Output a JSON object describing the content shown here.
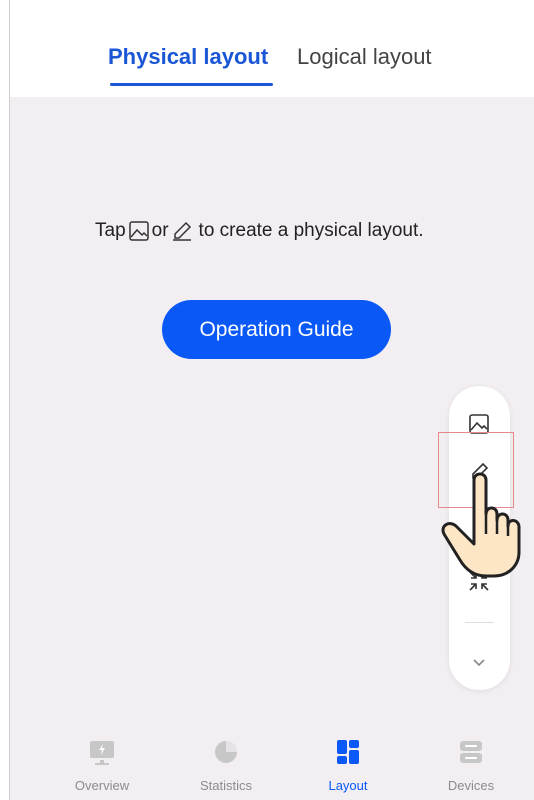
{
  "tabs": [
    {
      "label": "Physical layout",
      "active": true
    },
    {
      "label": "Logical layout",
      "active": false
    }
  ],
  "hint": {
    "prefix": "Tap",
    "icon1": "image-icon",
    "middle": "or",
    "icon2": "pen-icon",
    "suffix": "to create a physical layout."
  },
  "guide_button": "Operation Guide",
  "float_toolbar": {
    "icons": [
      "image-icon",
      "pen-icon",
      "shrink-icon",
      "chevron-down-icon"
    ]
  },
  "bottom_nav": [
    {
      "label": "Overview",
      "icon": "overview-icon",
      "active": false
    },
    {
      "label": "Statistics",
      "icon": "pie-chart-icon",
      "active": false
    },
    {
      "label": "Layout",
      "icon": "layout-icon",
      "active": true
    },
    {
      "label": "Devices",
      "icon": "devices-icon",
      "active": false
    }
  ],
  "colors": {
    "accent": "#0a59f7",
    "tab_active": "#1a56d6",
    "background": "#f2eef2",
    "nav_inactive": "#8c8c8c"
  }
}
